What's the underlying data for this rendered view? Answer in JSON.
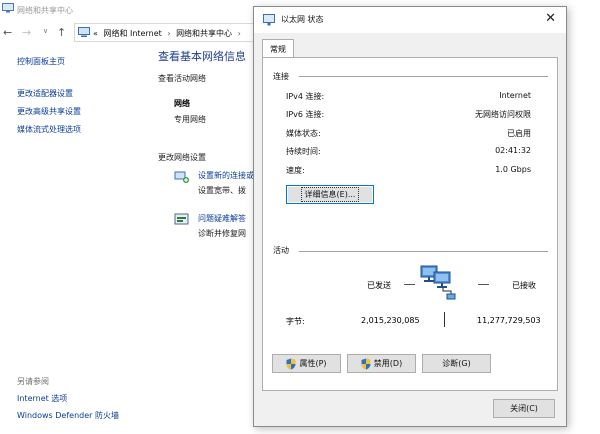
{
  "background": {
    "title": "网络和共享中心",
    "breadcrumb": {
      "overflow": "«",
      "items": [
        "网络和 Internet",
        "网络和共享中心"
      ]
    },
    "sidebar": {
      "home": "控制面板主页",
      "links": [
        "更改适配器设置",
        "更改高级共享设置",
        "媒体流式处理选项"
      ]
    },
    "see_also": {
      "header": "另请参阅",
      "links": [
        "Internet 选项",
        "Windows Defender 防火墙"
      ]
    },
    "main": {
      "title": "查看基本网络信息",
      "active_networks": "查看活动网络",
      "network_name": "网络",
      "network_type": "专用网络",
      "change_settings": "更改网络设置",
      "tasks": [
        {
          "link": "设置新的连接或",
          "desc": "设置宽带、拨"
        },
        {
          "link": "问题疑难解答",
          "desc": "诊断并修复网"
        }
      ]
    }
  },
  "dialog": {
    "title": "以太网 状态",
    "tab": "常规",
    "connection": {
      "header": "连接",
      "rows": [
        {
          "label": "IPv4 连接:",
          "value": "Internet"
        },
        {
          "label": "IPv6 连接:",
          "value": "无网络访问权限"
        },
        {
          "label": "媒体状态:",
          "value": "已启用"
        },
        {
          "label": "持续时间:",
          "value": "02:41:32"
        },
        {
          "label": "速度:",
          "value": "1.0 Gbps"
        }
      ],
      "details_button": "详细信息(E)..."
    },
    "activity": {
      "header": "活动",
      "sent_label": "已发送",
      "received_label": "已接收",
      "bytes_label": "字节:",
      "bytes_sent": "2,015,230,085",
      "bytes_received": "11,277,729,503"
    },
    "buttons": {
      "properties": "属性(P)",
      "disable": "禁用(D)",
      "diagnose": "诊断(G)",
      "close": "关闭(C)"
    }
  },
  "colors": {
    "link": "#0a3c9a",
    "title_blue": "#1e3d8c",
    "focus_border": "#0078d7"
  }
}
